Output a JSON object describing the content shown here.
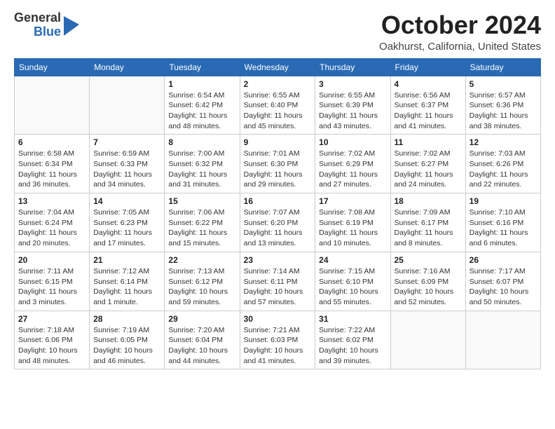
{
  "logo": {
    "general": "General",
    "blue": "Blue"
  },
  "title": "October 2024",
  "location": "Oakhurst, California, United States",
  "days_of_week": [
    "Sunday",
    "Monday",
    "Tuesday",
    "Wednesday",
    "Thursday",
    "Friday",
    "Saturday"
  ],
  "weeks": [
    [
      {
        "day": "",
        "content": ""
      },
      {
        "day": "",
        "content": ""
      },
      {
        "day": "1",
        "content": "Sunrise: 6:54 AM\nSunset: 6:42 PM\nDaylight: 11 hours and 48 minutes."
      },
      {
        "day": "2",
        "content": "Sunrise: 6:55 AM\nSunset: 6:40 PM\nDaylight: 11 hours and 45 minutes."
      },
      {
        "day": "3",
        "content": "Sunrise: 6:55 AM\nSunset: 6:39 PM\nDaylight: 11 hours and 43 minutes."
      },
      {
        "day": "4",
        "content": "Sunrise: 6:56 AM\nSunset: 6:37 PM\nDaylight: 11 hours and 41 minutes."
      },
      {
        "day": "5",
        "content": "Sunrise: 6:57 AM\nSunset: 6:36 PM\nDaylight: 11 hours and 38 minutes."
      }
    ],
    [
      {
        "day": "6",
        "content": "Sunrise: 6:58 AM\nSunset: 6:34 PM\nDaylight: 11 hours and 36 minutes."
      },
      {
        "day": "7",
        "content": "Sunrise: 6:59 AM\nSunset: 6:33 PM\nDaylight: 11 hours and 34 minutes."
      },
      {
        "day": "8",
        "content": "Sunrise: 7:00 AM\nSunset: 6:32 PM\nDaylight: 11 hours and 31 minutes."
      },
      {
        "day": "9",
        "content": "Sunrise: 7:01 AM\nSunset: 6:30 PM\nDaylight: 11 hours and 29 minutes."
      },
      {
        "day": "10",
        "content": "Sunrise: 7:02 AM\nSunset: 6:29 PM\nDaylight: 11 hours and 27 minutes."
      },
      {
        "day": "11",
        "content": "Sunrise: 7:02 AM\nSunset: 6:27 PM\nDaylight: 11 hours and 24 minutes."
      },
      {
        "day": "12",
        "content": "Sunrise: 7:03 AM\nSunset: 6:26 PM\nDaylight: 11 hours and 22 minutes."
      }
    ],
    [
      {
        "day": "13",
        "content": "Sunrise: 7:04 AM\nSunset: 6:24 PM\nDaylight: 11 hours and 20 minutes."
      },
      {
        "day": "14",
        "content": "Sunrise: 7:05 AM\nSunset: 6:23 PM\nDaylight: 11 hours and 17 minutes."
      },
      {
        "day": "15",
        "content": "Sunrise: 7:06 AM\nSunset: 6:22 PM\nDaylight: 11 hours and 15 minutes."
      },
      {
        "day": "16",
        "content": "Sunrise: 7:07 AM\nSunset: 6:20 PM\nDaylight: 11 hours and 13 minutes."
      },
      {
        "day": "17",
        "content": "Sunrise: 7:08 AM\nSunset: 6:19 PM\nDaylight: 11 hours and 10 minutes."
      },
      {
        "day": "18",
        "content": "Sunrise: 7:09 AM\nSunset: 6:17 PM\nDaylight: 11 hours and 8 minutes."
      },
      {
        "day": "19",
        "content": "Sunrise: 7:10 AM\nSunset: 6:16 PM\nDaylight: 11 hours and 6 minutes."
      }
    ],
    [
      {
        "day": "20",
        "content": "Sunrise: 7:11 AM\nSunset: 6:15 PM\nDaylight: 11 hours and 3 minutes."
      },
      {
        "day": "21",
        "content": "Sunrise: 7:12 AM\nSunset: 6:14 PM\nDaylight: 11 hours and 1 minute."
      },
      {
        "day": "22",
        "content": "Sunrise: 7:13 AM\nSunset: 6:12 PM\nDaylight: 10 hours and 59 minutes."
      },
      {
        "day": "23",
        "content": "Sunrise: 7:14 AM\nSunset: 6:11 PM\nDaylight: 10 hours and 57 minutes."
      },
      {
        "day": "24",
        "content": "Sunrise: 7:15 AM\nSunset: 6:10 PM\nDaylight: 10 hours and 55 minutes."
      },
      {
        "day": "25",
        "content": "Sunrise: 7:16 AM\nSunset: 6:09 PM\nDaylight: 10 hours and 52 minutes."
      },
      {
        "day": "26",
        "content": "Sunrise: 7:17 AM\nSunset: 6:07 PM\nDaylight: 10 hours and 50 minutes."
      }
    ],
    [
      {
        "day": "27",
        "content": "Sunrise: 7:18 AM\nSunset: 6:06 PM\nDaylight: 10 hours and 48 minutes."
      },
      {
        "day": "28",
        "content": "Sunrise: 7:19 AM\nSunset: 6:05 PM\nDaylight: 10 hours and 46 minutes."
      },
      {
        "day": "29",
        "content": "Sunrise: 7:20 AM\nSunset: 6:04 PM\nDaylight: 10 hours and 44 minutes."
      },
      {
        "day": "30",
        "content": "Sunrise: 7:21 AM\nSunset: 6:03 PM\nDaylight: 10 hours and 41 minutes."
      },
      {
        "day": "31",
        "content": "Sunrise: 7:22 AM\nSunset: 6:02 PM\nDaylight: 10 hours and 39 minutes."
      },
      {
        "day": "",
        "content": ""
      },
      {
        "day": "",
        "content": ""
      }
    ]
  ]
}
